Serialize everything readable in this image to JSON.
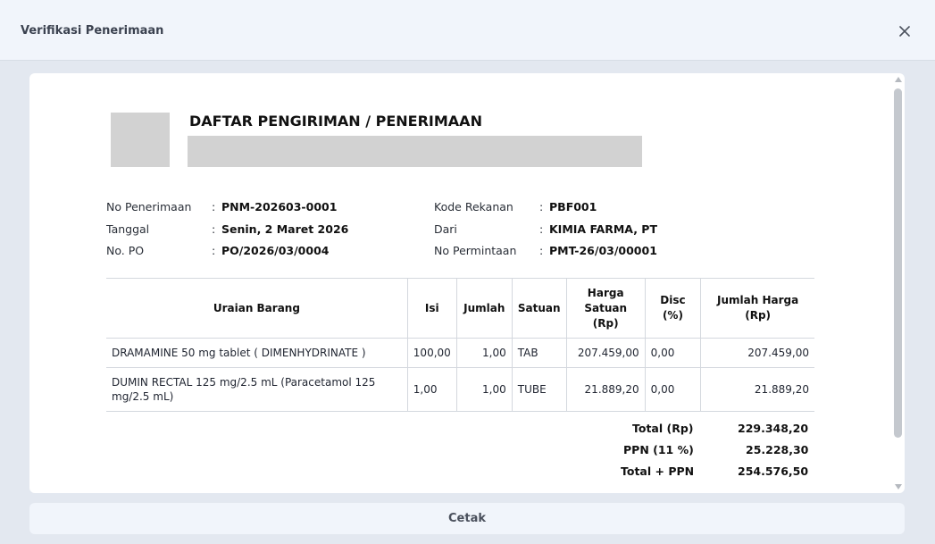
{
  "modal": {
    "title": "Verifikasi Penerimaan",
    "close_icon": "close-icon"
  },
  "document": {
    "title": "DAFTAR PENGIRIMAN / PENERIMAAN"
  },
  "info": {
    "left": [
      {
        "label": "No Penerimaan",
        "value": "PNM-202603-0001"
      },
      {
        "label": "Tanggal",
        "value": "Senin, 2 Maret 2026"
      },
      {
        "label": "No. PO",
        "value": "PO/2026/03/0004"
      }
    ],
    "right": [
      {
        "label": "Kode Rekanan",
        "value": "PBF001"
      },
      {
        "label": "Dari",
        "value": "KIMIA FARMA, PT"
      },
      {
        "label": "No Permintaan",
        "value": "PMT-26/03/00001"
      }
    ]
  },
  "table": {
    "headers": {
      "uraian": "Uraian Barang",
      "isi": "Isi",
      "jumlah": "Jumlah",
      "satuan": "Satuan",
      "harga_1": "Harga",
      "harga_2": "Satuan",
      "harga_3": "(Rp)",
      "disc_1": "Disc",
      "disc_2": "(%)",
      "total_1": "Jumlah Harga",
      "total_2": "(Rp)"
    },
    "rows": [
      {
        "uraian": "DRAMAMINE 50 mg tablet ( DIMENHYDRINATE )",
        "isi": "100,00",
        "jumlah": "1,00",
        "satuan": "TAB",
        "harga": "207.459,00",
        "disc": "0,00",
        "total": "207.459,00"
      },
      {
        "uraian": "DUMIN RECTAL 125 mg/2.5 mL (Paracetamol 125 mg/2.5 mL)",
        "isi": "1,00",
        "jumlah": "1,00",
        "satuan": "TUBE",
        "harga": "21.889,20",
        "disc": "0,00",
        "total": "21.889,20"
      }
    ]
  },
  "totals": {
    "total_label": "Total (Rp)",
    "total_value": "229.348,20",
    "ppn_label": "PPN (11 %)",
    "ppn_value": "25.228,30",
    "grand_label": "Total + PPN",
    "grand_value": "254.576,50"
  },
  "actions": {
    "print_label": "Cetak"
  }
}
